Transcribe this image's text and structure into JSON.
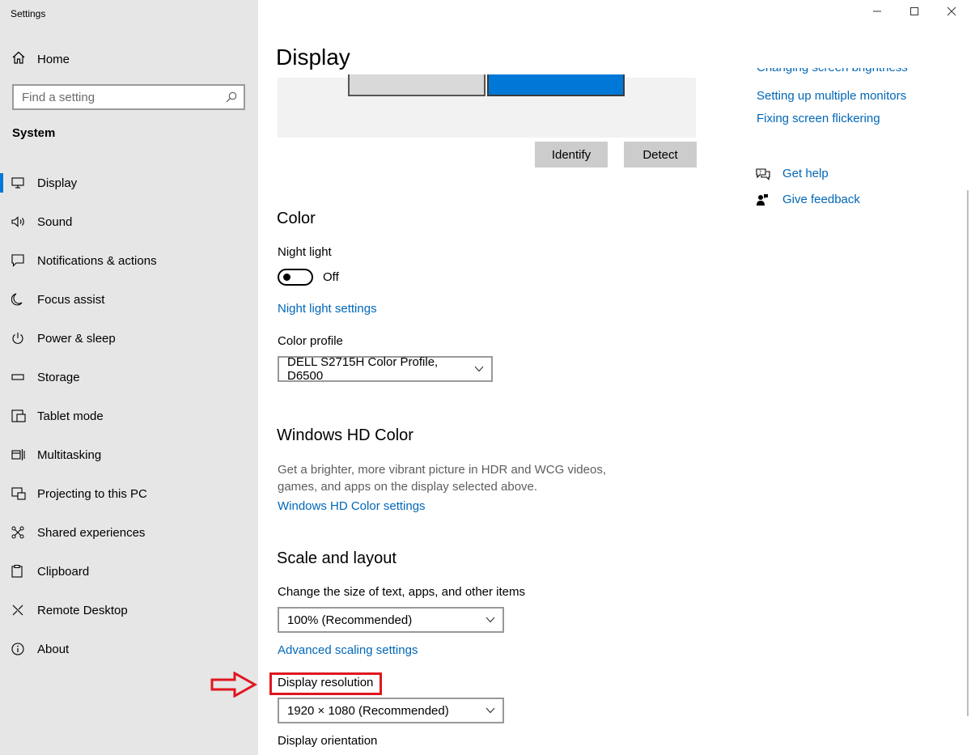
{
  "window": {
    "app_title": "Settings"
  },
  "sidebar": {
    "home_label": "Home",
    "search_placeholder": "Find a setting",
    "section_label": "System",
    "items": [
      {
        "label": "Display",
        "icon": "monitor-icon",
        "active": true
      },
      {
        "label": "Sound",
        "icon": "speaker-icon"
      },
      {
        "label": "Notifications & actions",
        "icon": "notification-icon"
      },
      {
        "label": "Focus assist",
        "icon": "moon-icon"
      },
      {
        "label": "Power & sleep",
        "icon": "power-icon"
      },
      {
        "label": "Storage",
        "icon": "storage-icon"
      },
      {
        "label": "Tablet mode",
        "icon": "tablet-icon"
      },
      {
        "label": "Multitasking",
        "icon": "multitasking-icon"
      },
      {
        "label": "Projecting to this PC",
        "icon": "projector-icon"
      },
      {
        "label": "Shared experiences",
        "icon": "shared-icon"
      },
      {
        "label": "Clipboard",
        "icon": "clipboard-icon"
      },
      {
        "label": "Remote Desktop",
        "icon": "remote-desktop-icon"
      },
      {
        "label": "About",
        "icon": "info-icon"
      }
    ]
  },
  "main": {
    "title": "Display",
    "identify_label": "Identify",
    "detect_label": "Detect",
    "color": {
      "heading": "Color",
      "night_light_label": "Night light",
      "night_light_state": "Off",
      "night_light_settings_link": "Night light settings",
      "color_profile_label": "Color profile",
      "color_profile_value": "DELL S2715H Color Profile, D6500"
    },
    "hd_color": {
      "heading": "Windows HD Color",
      "description": "Get a brighter, more vibrant picture in HDR and WCG videos, games, and apps on the display selected above.",
      "settings_link": "Windows HD Color settings"
    },
    "scale_layout": {
      "heading": "Scale and layout",
      "size_label": "Change the size of text, apps, and other items",
      "size_value": "100% (Recommended)",
      "advanced_link": "Advanced scaling settings",
      "resolution_label": "Display resolution",
      "resolution_value": "1920 × 1080 (Recommended)",
      "orientation_label": "Display orientation"
    }
  },
  "related": {
    "links": [
      "Changing screen brightness",
      "Setting up multiple monitors",
      "Fixing screen flickering"
    ],
    "get_help": "Get help",
    "give_feedback": "Give feedback"
  },
  "colors": {
    "accent": "#0078d7",
    "link": "#0067b8",
    "highlight": "#e0161e",
    "sidebar_bg": "#e6e6e6"
  }
}
